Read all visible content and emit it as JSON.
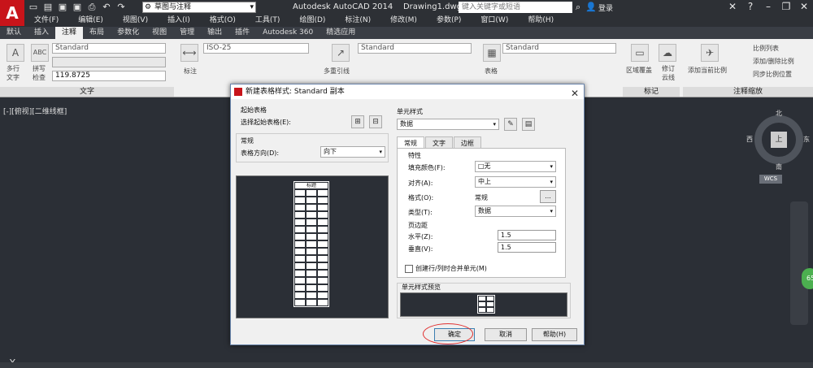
{
  "titlebar": {
    "logo": "A",
    "workspace": "草图与注释",
    "title": "Autodesk AutoCAD 2014    Drawing1.dwg",
    "search_placeholder": "键入关键字或短语",
    "login": "登录"
  },
  "menu": [
    "文件(F)",
    "编辑(E)",
    "视图(V)",
    "插入(I)",
    "格式(O)",
    "工具(T)",
    "绘图(D)",
    "标注(N)",
    "修改(M)",
    "参数(P)",
    "窗口(W)",
    "帮助(H)"
  ],
  "ribbon_tabs": [
    "默认",
    "插入",
    "注释",
    "布局",
    "参数化",
    "视图",
    "管理",
    "输出",
    "插件",
    "Autodesk 360",
    "精选应用"
  ],
  "ribbon": {
    "text_style": "Standard",
    "text_height": "119.8725",
    "multiline_text": "多行\n文字",
    "spell_check": "拼写\n检查",
    "dim_style": "ISO-25",
    "dimension": "标注",
    "multileader": "多重引线",
    "leader_style": "Standard",
    "table_style": "Standard",
    "table": "表格",
    "wipeout": "区域覆盖",
    "revcloud": "修订\n云线",
    "add_scale": "添加当前比例",
    "scale_list": "比例列表",
    "add_delete_scales": "添加/删除比例",
    "sync_scale": "同步比例位置",
    "panel_text": "文字",
    "panel_markup": "标记",
    "panel_annoscale": "注释缩放"
  },
  "viewport": {
    "label": "[-][俯视][二维线框]",
    "north": "北",
    "south": "南",
    "east": "东",
    "west": "西",
    "top": "上",
    "wcs": "WCS",
    "badge": "65"
  },
  "dialog": {
    "title": "新建表格样式: Standard 副本",
    "starting_table": "起始表格",
    "select_start": "选择起始表格(E):",
    "general": "常规",
    "table_direction": "表格方向(D):",
    "table_direction_value": "向下",
    "cell_styles": "单元样式",
    "cell_style_value": "数据",
    "tabs": [
      "常规",
      "文字",
      "边框"
    ],
    "properties": "特性",
    "fill_color": "填充颜色(F):",
    "fill_color_value": "□无",
    "alignment": "对齐(A):",
    "alignment_value": "中上",
    "format": "格式(O):",
    "format_value": "常规",
    "format_btn": "...",
    "type": "类型(T):",
    "type_value": "数据",
    "margins": "页边距",
    "horizontal": "水平(Z):",
    "horizontal_value": "1.5",
    "vertical": "垂直(V):",
    "vertical_value": "1.5",
    "merge_cells": "创建行/列时合并单元(M)",
    "cell_preview": "单元样式预览",
    "preview_title": "标题",
    "ok": "确定",
    "cancel": "取消",
    "help": "帮助(H)"
  }
}
